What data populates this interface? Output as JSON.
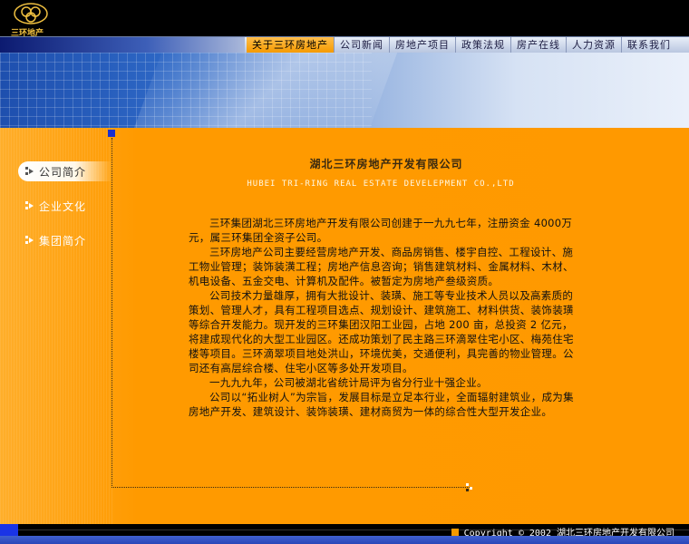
{
  "brand": {
    "logo_text": "三环地产"
  },
  "nav": {
    "items": [
      {
        "label": "关于三环房地产",
        "active": true
      },
      {
        "label": "公司新闻",
        "active": false
      },
      {
        "label": "房地产项目",
        "active": false
      },
      {
        "label": "政策法规",
        "active": false
      },
      {
        "label": "房产在线",
        "active": false
      },
      {
        "label": "人力资源",
        "active": false
      },
      {
        "label": "联系我们",
        "active": false
      }
    ]
  },
  "sidebar": {
    "items": [
      {
        "label": "公司简介",
        "active": true
      },
      {
        "label": "企业文化",
        "active": false
      },
      {
        "label": "集团简介",
        "active": false
      }
    ]
  },
  "content": {
    "title": "湖北三环房地产开发有限公司",
    "title_en": "HUBEI TRI-RING REAL ESTATE DEVELEPMENT CO.,LTD",
    "paragraphs": [
      "三环集团湖北三环房地产开发有限公司创建于一九九七年，注册资金 4000万元，属三环集团全资子公司。",
      "三环房地产公司主要经营房地产开发、商品房销售、楼宇自控、工程设计、施工物业管理；装饰装潢工程；房地产信息咨询；销售建筑材料、金属材料、木材、机电设备、五金交电、计算机及配件。被暂定为房地产叁级资质。",
      "公司技术力量雄厚，拥有大批设计、装璜、施工等专业技术人员以及高素质的策划、管理人才，具有工程项目选点、规划设计、建筑施工、材料供货、装饰装璜等综合开发能力。现开发的三环集团汉阳工业园，占地 200 亩，总投资 2 亿元，将建成现代化的大型工业园区。还成功策划了民主路三环滴翠住宅小区、梅苑住宅楼等项目。三环滴翠项目地处洪山，环境优美，交通便利，具完善的物业管理。公司还有高层综合楼、住宅小区等多处开发项目。",
      "一九九九年，公司被湖北省统计局评为省分行业十强企业。",
      "公司以“拓业树人”为宗旨，发展目标是立足本行业，全面辐射建筑业，成为集房地产开发、建筑设计、装饰装璜、建材商贸为一体的综合性大型开发企业。"
    ]
  },
  "footer": {
    "copyright": "Copyright © 2002 湖北三环房地产开发有限公司"
  },
  "colors": {
    "orange": "#ff9900",
    "nav_active": "#f59a00",
    "blue": "#1a34e6",
    "black": "#000000"
  }
}
